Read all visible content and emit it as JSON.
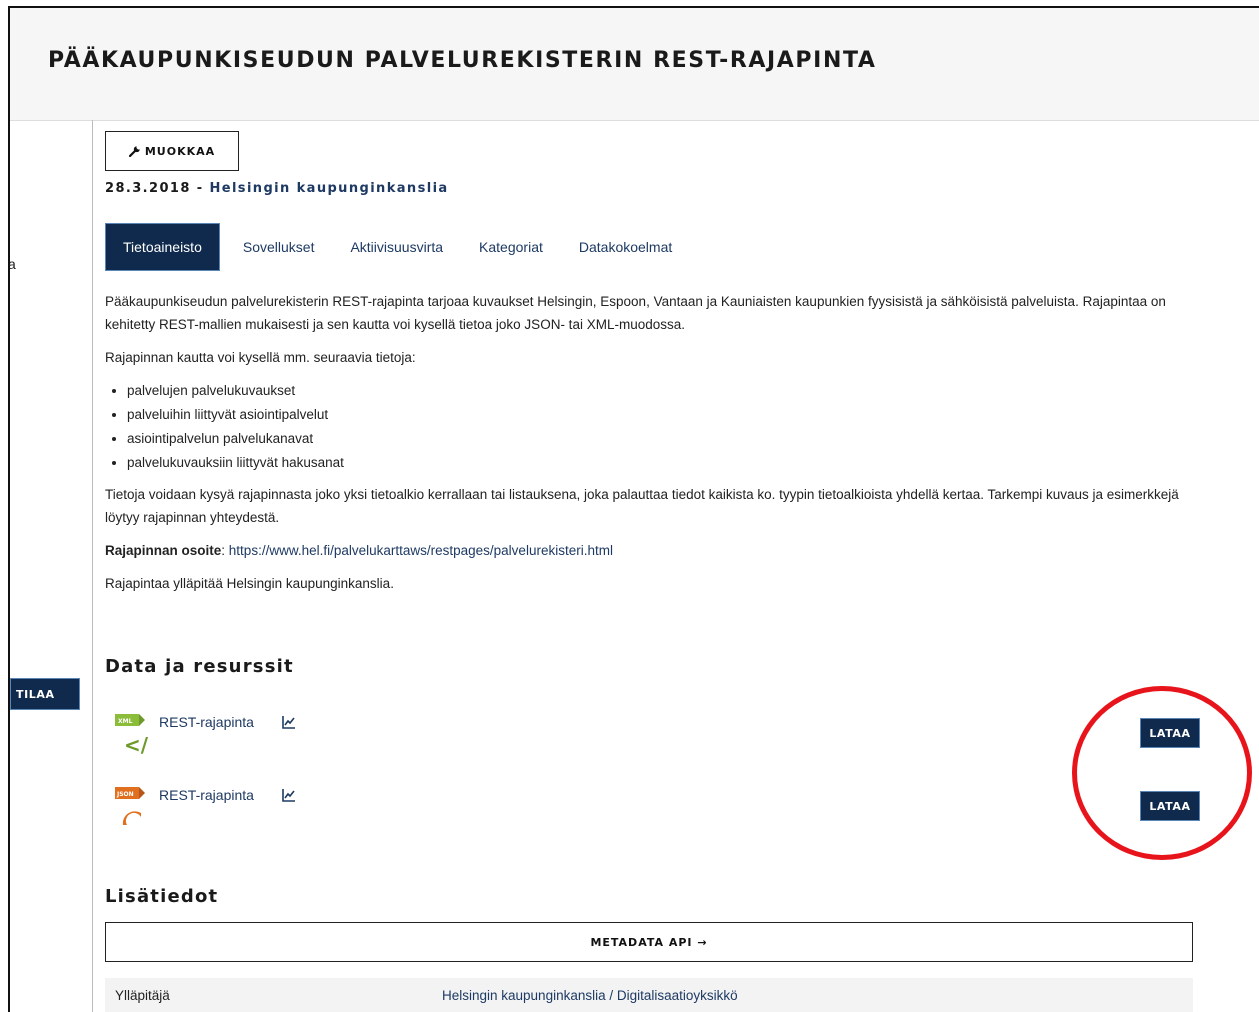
{
  "header": {
    "title": "PÄÄKAUPUNKISEUDUN PALVELUREKISTERIN REST-RAJAPINTA"
  },
  "sidebar": {
    "partial_letter": "a",
    "subscribe_label": "TILAA"
  },
  "edit_button": {
    "label": "MUOKKAA",
    "icon": "wrench-icon"
  },
  "dataset_meta": {
    "date": "28.3.2018",
    "separator": " - ",
    "organization": "Helsingin kaupunginkanslia"
  },
  "tabs": [
    {
      "label": "Tietoaineisto",
      "active": true
    },
    {
      "label": "Sovellukset",
      "active": false
    },
    {
      "label": "Aktiivisuusvirta",
      "active": false
    },
    {
      "label": "Kategoriat",
      "active": false
    },
    {
      "label": "Datakokoelmat",
      "active": false
    }
  ],
  "description": {
    "para1": "Pääkaupunkiseudun palvelurekisterin REST-rajapinta tarjoaa kuvaukset Helsingin, Espoon, Vantaan ja Kauniaisten kaupunkien fyysisistä ja sähköisistä palveluista. Rajapintaa on kehitetty REST-mallien mukaisesti ja sen kautta voi kysellä tietoa joko JSON- tai XML-muodossa.",
    "para2": "Rajapinnan kautta voi kysellä mm. seuraavia tietoja:",
    "list": [
      "palvelujen palvelukuvaukset",
      "palveluihin liittyvät asiointipalvelut",
      "asiointipalvelun palvelukanavat",
      "palvelukuvauksiin liittyvät hakusanat"
    ],
    "para3": "Tietoja voidaan kysyä rajapinnasta joko yksi tietoalkio kerrallaan tai listauksena, joka palauttaa tiedot kaikista ko. tyypin tietoalkioista yhdellä kertaa. Tarkempi kuvaus ja esimerkkejä löytyy rajapinnan yhteydestä.",
    "address_label": "Rajapinnan osoite",
    "address_colon": ": ",
    "address_url": "https://www.hel.fi/palvelukarttaws/restpages/palvelurekisteri.html",
    "para4": "Rajapintaa ylläpitää Helsingin kaupunginkanslia."
  },
  "resources_section": {
    "title": "Data ja resurssit",
    "items": [
      {
        "title": "REST-rajapinta",
        "format": "XML",
        "icon": "xml-file-icon",
        "download_label": "LATAA"
      },
      {
        "title": "REST-rajapinta",
        "format": "JSON",
        "icon": "json-file-icon",
        "download_label": "LATAA"
      }
    ]
  },
  "additional_info": {
    "title": "Lisätiedot",
    "metadata_button": "METADATA API →",
    "rows": [
      {
        "key": "Ylläpitäjä",
        "value": "Helsingin kaupunginkanslia / Digitalisaatioyksikkö"
      }
    ]
  },
  "colors": {
    "primary": "#0f2a4c",
    "link": "#1e3a63",
    "highlight_circle": "#e8141b",
    "xml_icon": "#8bbd3a",
    "json_icon": "#e07020"
  }
}
